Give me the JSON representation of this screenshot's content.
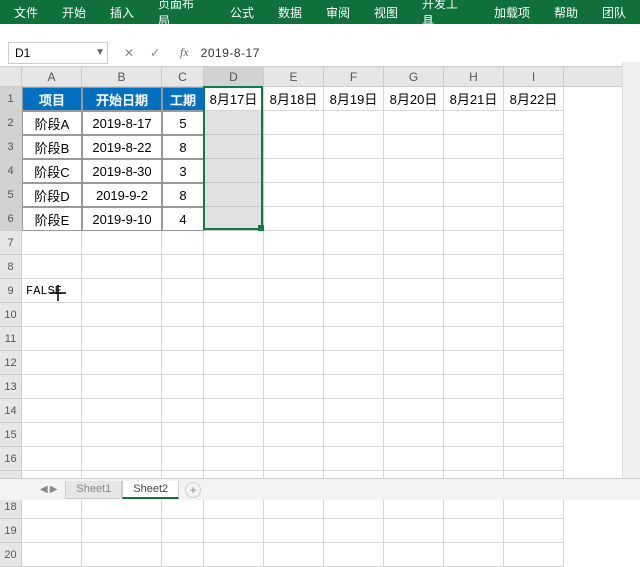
{
  "ribbon": {
    "tabs": [
      "文件",
      "开始",
      "插入",
      "页面布局",
      "公式",
      "数据",
      "审阅",
      "视图",
      "开发工具",
      "加载项",
      "帮助",
      "团队"
    ]
  },
  "name_box": {
    "value": "D1"
  },
  "formula_bar": {
    "value": "2019-8-17"
  },
  "columns": [
    {
      "label": "A",
      "width": 60
    },
    {
      "label": "B",
      "width": 80
    },
    {
      "label": "C",
      "width": 42
    },
    {
      "label": "D",
      "width": 60
    },
    {
      "label": "E",
      "width": 60
    },
    {
      "label": "F",
      "width": 60
    },
    {
      "label": "G",
      "width": 60
    },
    {
      "label": "H",
      "width": 60
    },
    {
      "label": "I",
      "width": 60
    }
  ],
  "selected_col": "D",
  "selected_rows": [
    1,
    2,
    3,
    4,
    5,
    6
  ],
  "table": {
    "headers": {
      "project": "项目",
      "start": "开始日期",
      "dur": "工期"
    },
    "rows": [
      {
        "project": "阶段A",
        "start": "2019-8-17",
        "dur": "5"
      },
      {
        "project": "阶段B",
        "start": "2019-8-22",
        "dur": "8"
      },
      {
        "project": "阶段C",
        "start": "2019-8-30",
        "dur": "3"
      },
      {
        "project": "阶段D",
        "start": "2019-9-2",
        "dur": "8"
      },
      {
        "project": "阶段E",
        "start": "2019-9-10",
        "dur": "4"
      }
    ]
  },
  "dates_row": [
    "8月17日",
    "8月18日",
    "8月19日",
    "8月20日",
    "8月21日",
    "8月22日"
  ],
  "cell_a9": "FALSE",
  "sheet_tabs": [
    {
      "name": "Sheet1",
      "active": false
    },
    {
      "name": "Sheet2",
      "active": true
    }
  ],
  "total_rows": 20
}
